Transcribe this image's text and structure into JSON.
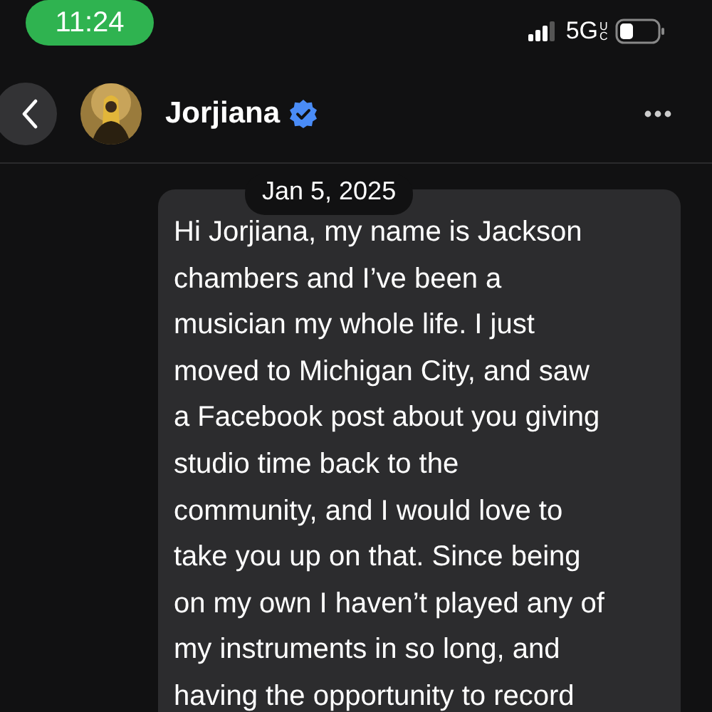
{
  "status_bar": {
    "time": "11:24",
    "network": "5G",
    "network_suffix": "UC"
  },
  "header": {
    "name": "Jorjiana",
    "verified": true
  },
  "date_label": "Jan 5, 2025",
  "message": {
    "lines": [
      "Hi Jorjiana, my name is Jackson",
      "chambers and I’ve been a",
      "musician my whole life. I just",
      "moved to Michigan City, and saw",
      "a Facebook post about you giving",
      "studio time back to the",
      "community, and I would love to",
      "take you up on that. Since being",
      "on my own I haven’t played any of",
      "my instruments in so long, and",
      "having the opportunity to record"
    ]
  }
}
